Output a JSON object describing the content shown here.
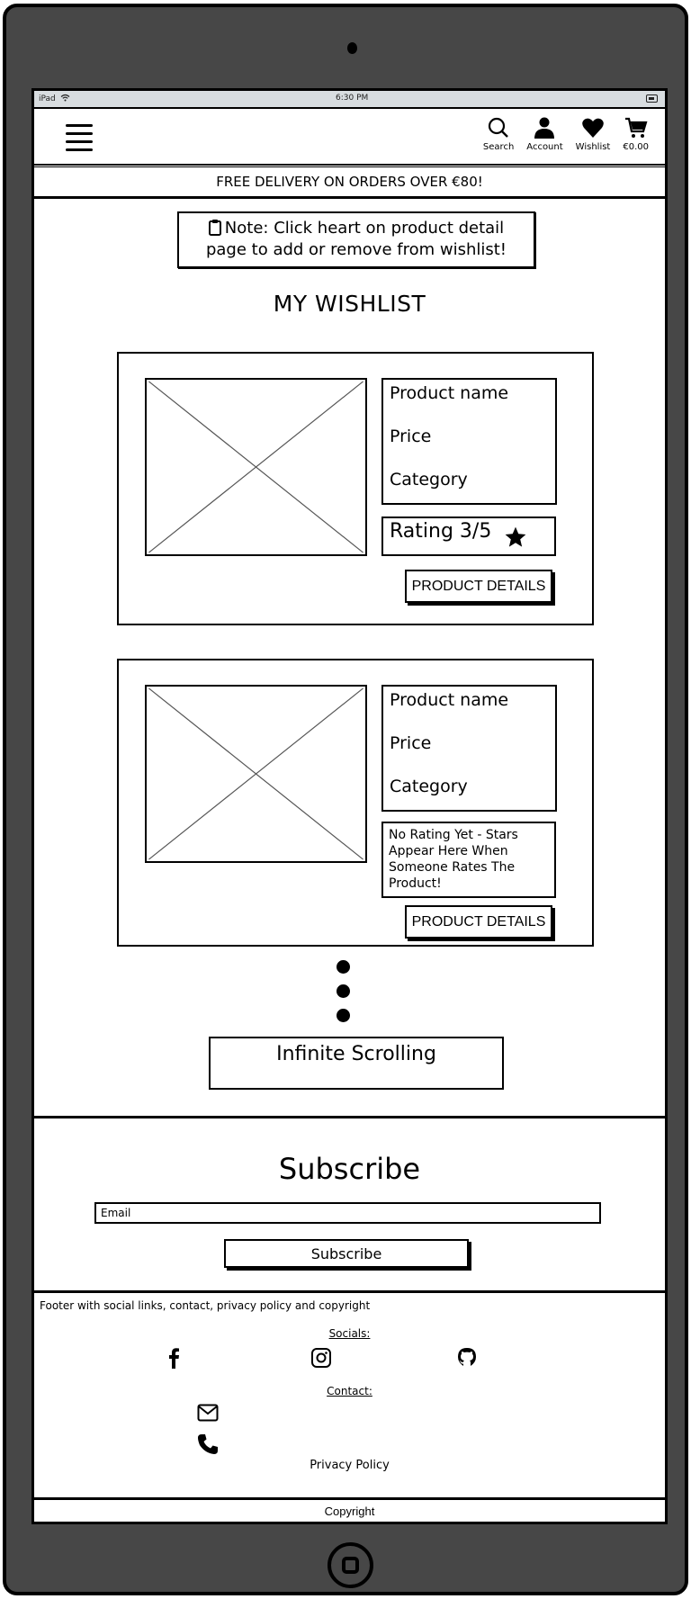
{
  "status_bar": {
    "device": "iPad",
    "time": "6:30 PM"
  },
  "navbar": {
    "items": [
      {
        "label": "Search",
        "icon": "search-icon"
      },
      {
        "label": "Account",
        "icon": "account-icon"
      },
      {
        "label": "Wishlist",
        "icon": "heart-icon"
      },
      {
        "label": "€0.00",
        "icon": "cart-icon"
      }
    ]
  },
  "banner": {
    "text": "FREE DELIVERY ON ORDERS OVER €80!"
  },
  "note": {
    "line1": "Note: Click heart on product detail",
    "line2": "page to add or remove from wishlist!",
    "icon": "clipboard-icon"
  },
  "page_title": "MY WISHLIST",
  "products": [
    {
      "name": "Product name",
      "price": "Price",
      "category": "Category",
      "rating_text": "Rating 3/5",
      "button": "PRODUCT DETAILS"
    },
    {
      "name": "Product name",
      "price": "Price",
      "category": "Category",
      "no_rating_text": "No Rating Yet - Stars Appear Here When Someone Rates The Product!",
      "button": "PRODUCT DETAILS"
    }
  ],
  "infinite_scroll": {
    "label": "Infinite Scrolling"
  },
  "subscribe": {
    "title": "Subscribe",
    "email_placeholder": "Email",
    "button": "Subscribe"
  },
  "footer": {
    "description": "Footer with social links, contact, privacy policy and copyright",
    "socials_label": "Socials:",
    "socials": [
      "facebook-icon",
      "instagram-icon",
      "github-icon"
    ],
    "contact_label": "Contact:",
    "contacts": [
      "envelope-icon",
      "phone-icon"
    ],
    "privacy": "Privacy Policy",
    "copyright": "Copyright"
  }
}
